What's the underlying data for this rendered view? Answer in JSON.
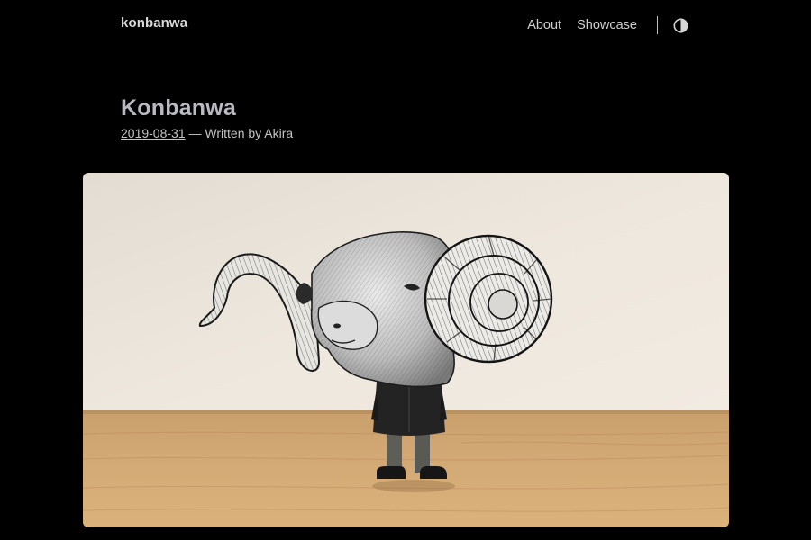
{
  "header": {
    "site_title": "konbanwa",
    "nav": [
      {
        "label": "About"
      },
      {
        "label": "Showcase"
      }
    ],
    "theme_toggle_icon": "half-circle-contrast-icon"
  },
  "post": {
    "title": "Konbanwa",
    "date": "2019-08-31",
    "byline": " — Written by Akira"
  },
  "cover_image": {
    "subject": "ram-head-figurine-photo"
  },
  "colors": {
    "background": "#000000",
    "text": "#d6d6d6",
    "title": "#b9b9c2"
  }
}
